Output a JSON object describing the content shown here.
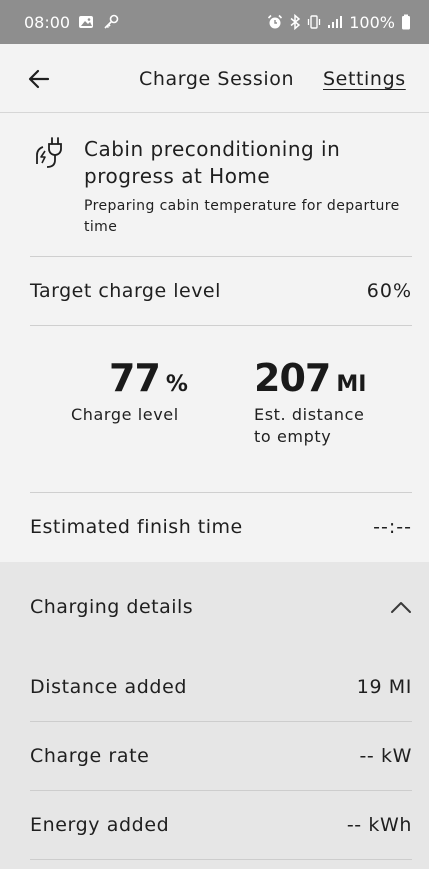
{
  "status_bar": {
    "time": "08:00",
    "battery": "100%",
    "left_icons": [
      "image-icon",
      "key-icon"
    ],
    "right_icons": [
      "alarm-icon",
      "bluetooth-icon",
      "vibrate-icon",
      "signal-icon",
      "battery-icon"
    ]
  },
  "header": {
    "title": "Charge Session",
    "settings_label": "Settings"
  },
  "status_card": {
    "icon": "plug-charging-icon",
    "title": "Cabin preconditioning in progress at Home",
    "subtitle": "Preparing cabin temperature for departure time"
  },
  "target_charge": {
    "label": "Target charge level",
    "value": "60%"
  },
  "metrics": {
    "charge_level": {
      "value": "77",
      "unit": "%",
      "label": "Charge level"
    },
    "distance": {
      "value": "207",
      "unit": "MI",
      "label": "Est. distance to empty"
    }
  },
  "finish_time": {
    "label": "Estimated finish time",
    "value": "--:--"
  },
  "details": {
    "title": "Charging details",
    "rows": [
      {
        "label": "Distance added",
        "value": "19 MI"
      },
      {
        "label": "Charge rate",
        "value": "-- kW"
      },
      {
        "label": "Energy added",
        "value": "-- kWh"
      }
    ]
  },
  "colors": {
    "status_bar": "#8e8e8e",
    "background": "#f3f3f3",
    "details_background": "#e6e6e6",
    "text": "#1f1f1f"
  }
}
